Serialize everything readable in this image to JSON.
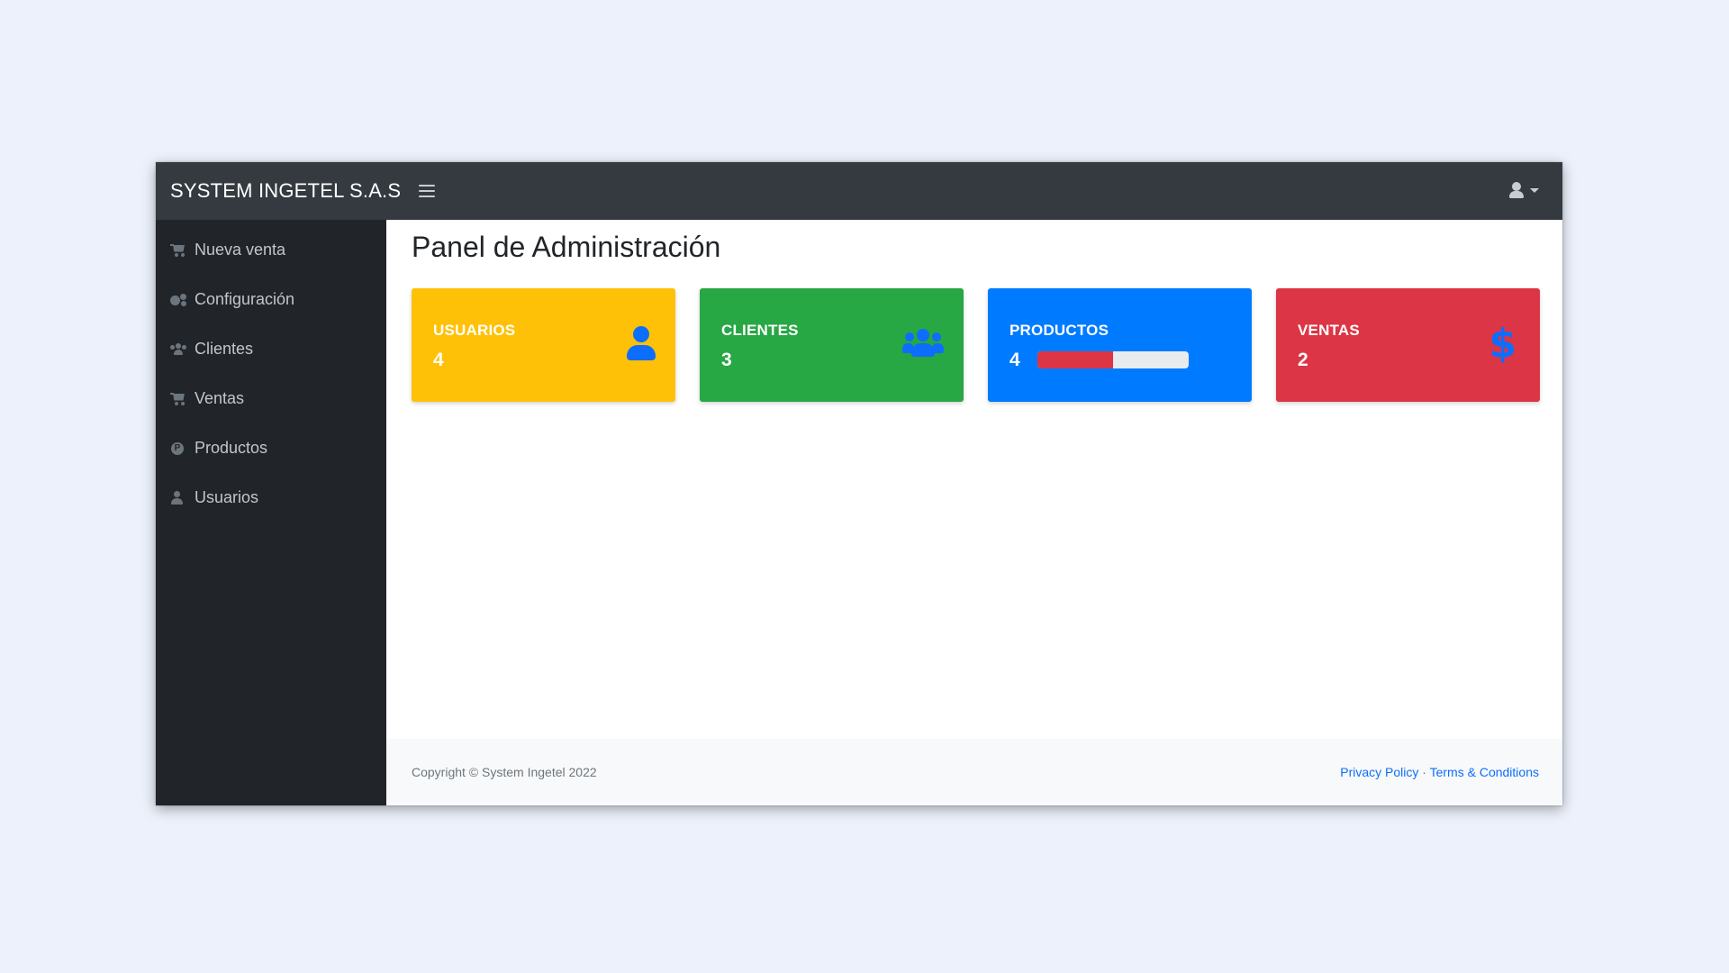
{
  "navbar": {
    "brand": "SYSTEM INGETEL S.A.S",
    "toggle_icon": "bars-icon",
    "user_icon": "user-icon"
  },
  "sidebar": {
    "items": [
      {
        "label": "Nueva venta",
        "icon": "cart-icon"
      },
      {
        "label": "Configuración",
        "icon": "cogs-icon"
      },
      {
        "label": "Clientes",
        "icon": "users-icon"
      },
      {
        "label": "Ventas",
        "icon": "cart-icon"
      },
      {
        "label": "Productos",
        "icon": "product-icon"
      },
      {
        "label": "Usuarios",
        "icon": "user-icon"
      }
    ]
  },
  "main": {
    "title": "Panel de Administración",
    "cards": [
      {
        "label": "USUARIOS",
        "value": "4",
        "color": "#ffc107",
        "icon": "user-icon"
      },
      {
        "label": "CLIENTES",
        "value": "3",
        "color": "#28a745",
        "icon": "users-icon"
      },
      {
        "label": "PRODUCTOS",
        "value": "4",
        "color": "#007bff",
        "progress": 0.5
      },
      {
        "label": "VENTAS",
        "value": "2",
        "color": "#dc3545",
        "icon": "dollar-icon"
      }
    ]
  },
  "footer": {
    "copyright": "Copyright © System Ingetel 2022",
    "privacy": "Privacy Policy",
    "separator": "·",
    "terms": "Terms & Conditions"
  },
  "colors": {
    "navbar_bg": "#343a40",
    "sidebar_bg": "#212529",
    "icon_accent": "#0d6efd",
    "progress_fill": "#dc3545"
  }
}
